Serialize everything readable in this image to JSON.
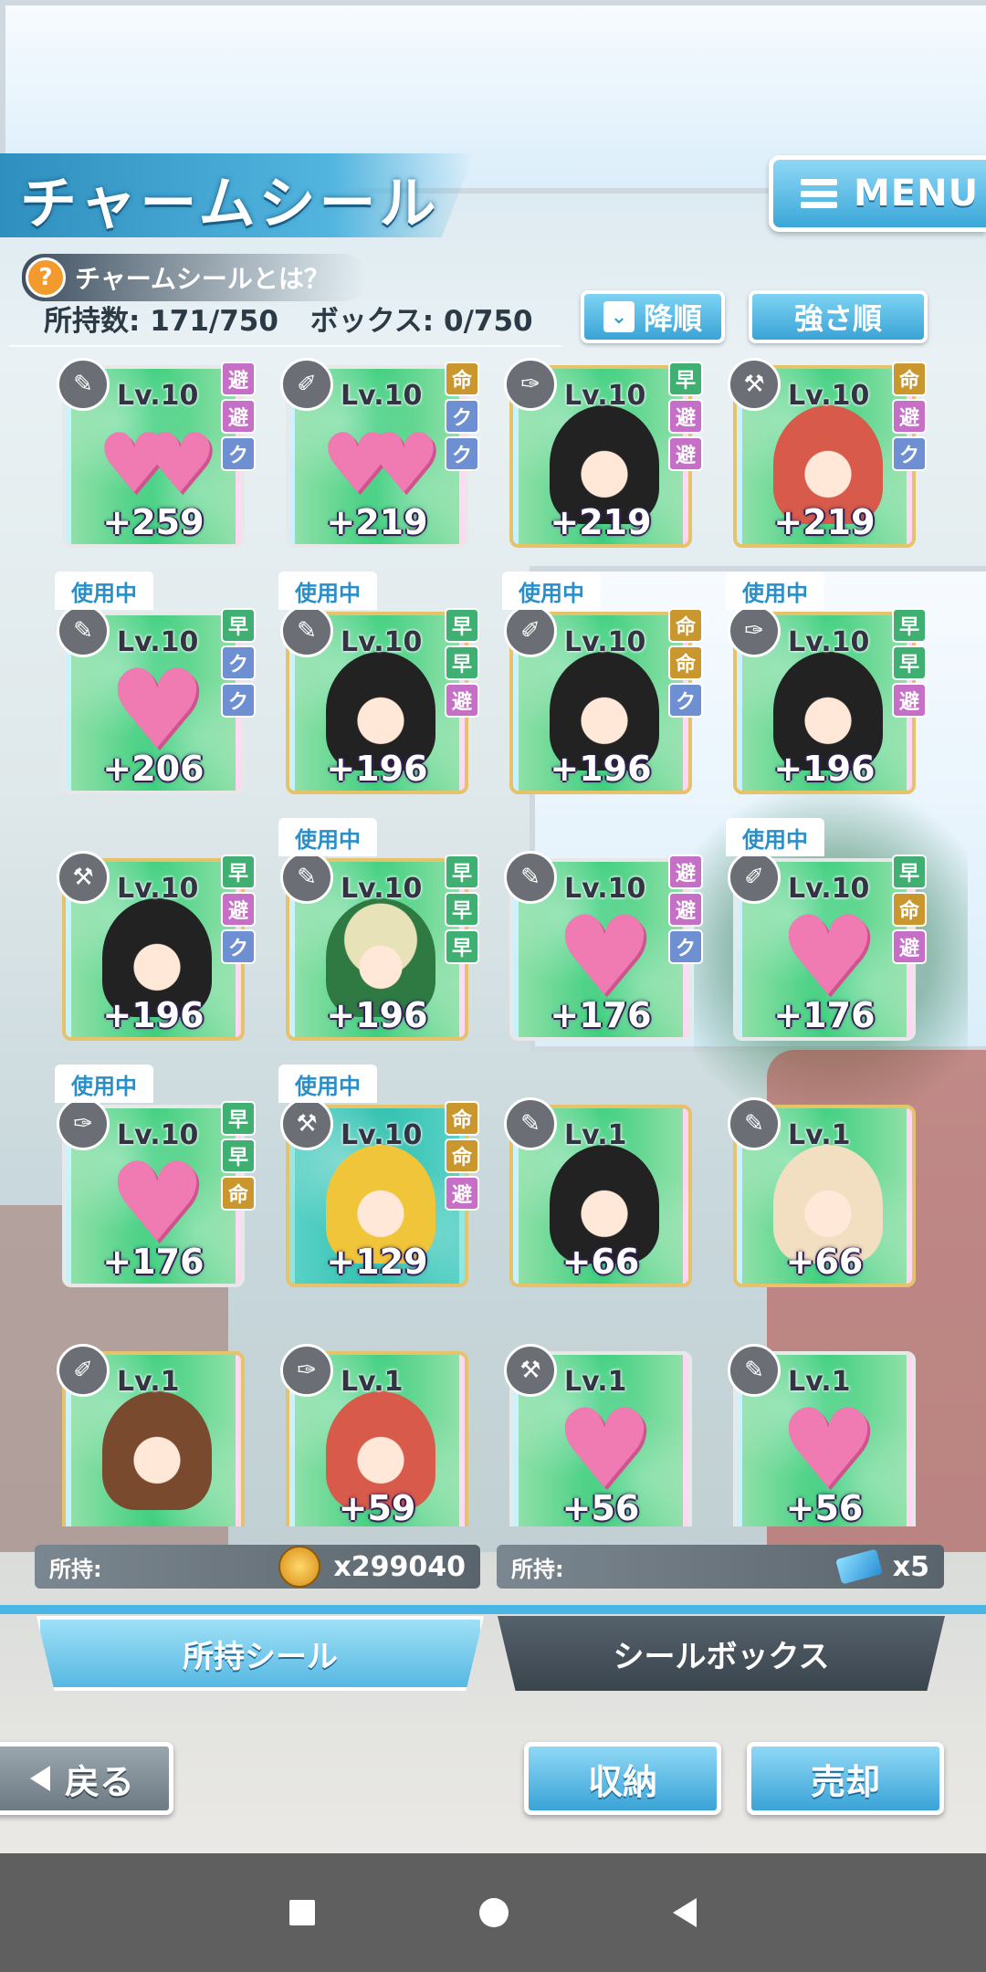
{
  "header": {
    "title": "チャームシール",
    "menu_label": "MENU"
  },
  "help": {
    "icon": "question-icon",
    "label": "チャームシールとは？"
  },
  "counts": {
    "owned": "所持数: 171/750",
    "box": "ボックス: 0/750"
  },
  "sort": {
    "order": "降順",
    "by": "強さ順"
  },
  "colors": {
    "accent": "#3aa3d6",
    "card_green": "#3fcf7f",
    "heart": "#f07bb2"
  },
  "stickers": [
    {
      "level": "Lv.10",
      "value": "+259",
      "in_use": "",
      "tags": [
        "避",
        "避",
        "ク"
      ],
      "art": "hearts-2"
    },
    {
      "level": "Lv.10",
      "value": "+219",
      "in_use": "",
      "tags": [
        "命",
        "ク",
        "ク"
      ],
      "art": "hearts-2"
    },
    {
      "level": "Lv.10",
      "value": "+219",
      "in_use": "",
      "tags": [
        "早",
        "避",
        "避"
      ],
      "art": "black"
    },
    {
      "level": "Lv.10",
      "value": "+219",
      "in_use": "",
      "tags": [
        "命",
        "避",
        "ク"
      ],
      "art": "red"
    },
    {
      "level": "Lv.10",
      "value": "+206",
      "in_use": "使用中",
      "tags": [
        "早",
        "ク",
        "ク"
      ],
      "art": "heart"
    },
    {
      "level": "Lv.10",
      "value": "+196",
      "in_use": "使用中",
      "tags": [
        "早",
        "早",
        "避"
      ],
      "art": "black"
    },
    {
      "level": "Lv.10",
      "value": "+196",
      "in_use": "使用中",
      "tags": [
        "命",
        "命",
        "ク"
      ],
      "art": "black"
    },
    {
      "level": "Lv.10",
      "value": "+196",
      "in_use": "使用中",
      "tags": [
        "早",
        "早",
        "避"
      ],
      "art": "black"
    },
    {
      "level": "Lv.10",
      "value": "+196",
      "in_use": "",
      "tags": [
        "早",
        "避",
        "ク"
      ],
      "art": "black"
    },
    {
      "level": "Lv.10",
      "value": "+196",
      "in_use": "使用中",
      "tags": [
        "早",
        "早",
        "早"
      ],
      "art": "green"
    },
    {
      "level": "Lv.10",
      "value": "+176",
      "in_use": "",
      "tags": [
        "避",
        "避",
        "ク"
      ],
      "art": "heart"
    },
    {
      "level": "Lv.10",
      "value": "+176",
      "in_use": "使用中",
      "tags": [
        "早",
        "命",
        "避"
      ],
      "art": "heart"
    },
    {
      "level": "Lv.10",
      "value": "+176",
      "in_use": "使用中",
      "tags": [
        "早",
        "早",
        "命"
      ],
      "art": "heart"
    },
    {
      "level": "Lv.10",
      "value": "+129",
      "in_use": "使用中",
      "tags": [
        "命",
        "命",
        "避"
      ],
      "art": "blond"
    },
    {
      "level": "Lv.1",
      "value": "+66",
      "in_use": "",
      "tags": [],
      "art": "black"
    },
    {
      "level": "Lv.1",
      "value": "+66",
      "in_use": "",
      "tags": [],
      "art": "cream"
    },
    {
      "level": "Lv.1",
      "value": "",
      "in_use": "",
      "tags": [],
      "art": "brown"
    },
    {
      "level": "Lv.1",
      "value": "+59",
      "in_use": "",
      "tags": [],
      "art": "red"
    },
    {
      "level": "Lv.1",
      "value": "+56",
      "in_use": "",
      "tags": [],
      "art": "heart"
    },
    {
      "level": "Lv.1",
      "value": "+56",
      "in_use": "",
      "tags": [],
      "art": "heart"
    }
  ],
  "currency": [
    {
      "label": "所持:",
      "icon": "coin-icon",
      "value": "x299040"
    },
    {
      "label": "所持:",
      "icon": "ticket-icon",
      "value": "x5"
    }
  ],
  "tabs": [
    {
      "label": "所持シール",
      "active": true
    },
    {
      "label": "シールボックス",
      "active": false
    }
  ],
  "buttons": {
    "back": "戻る",
    "store": "収納",
    "sell": "売却"
  }
}
